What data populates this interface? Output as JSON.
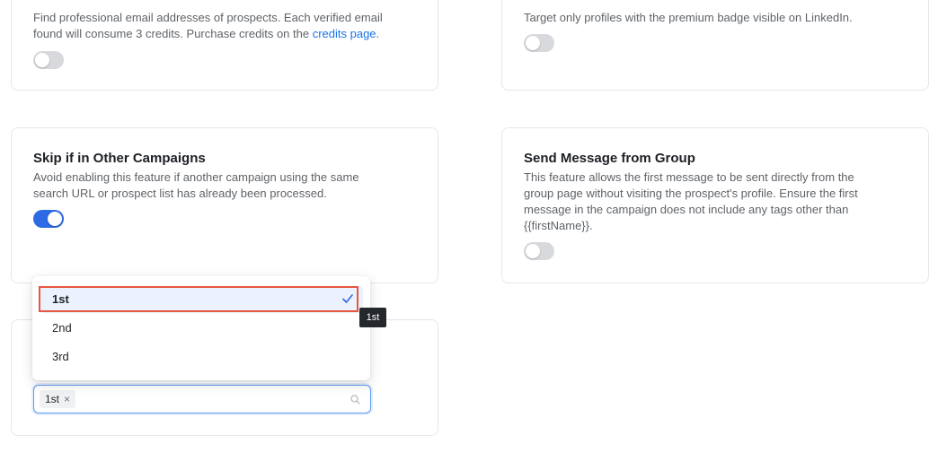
{
  "cards": {
    "email": {
      "desc_line1": "Find professional email addresses of prospects. Each verified email",
      "desc_line2_pre": "found will consume 3 credits. Purchase credits on the ",
      "desc_link": "credits page",
      "desc_line2_post": ".",
      "toggle_on": false
    },
    "premium": {
      "desc_line1": "Target only profiles with the premium badge visible on LinkedIn.",
      "toggle_on": false
    },
    "skip": {
      "title": "Skip if in Other Campaigns",
      "desc_line1": "Avoid enabling this feature if another campaign using the same",
      "desc_line2": "search URL or prospect list has already been processed.",
      "toggle_on": true
    },
    "group": {
      "title": "Send Message from Group",
      "desc_line1": "This feature allows the first message to be sent directly from the",
      "desc_line2": "group page without visiting the prospect's profile. Ensure the first",
      "desc_line3": "message in the campaign does not include any tags other than",
      "desc_line4": "{{firstName}}.",
      "toggle_on": false
    }
  },
  "dropdown": {
    "options": [
      {
        "label": "1st",
        "selected": true
      },
      {
        "label": "2nd",
        "selected": false
      },
      {
        "label": "3rd",
        "selected": false
      }
    ],
    "tooltip": "1st"
  },
  "select": {
    "tags": [
      "1st"
    ]
  },
  "colors": {
    "accent": "#2d6ae3",
    "highlight": "#e5573f",
    "link": "#1a73e8"
  }
}
